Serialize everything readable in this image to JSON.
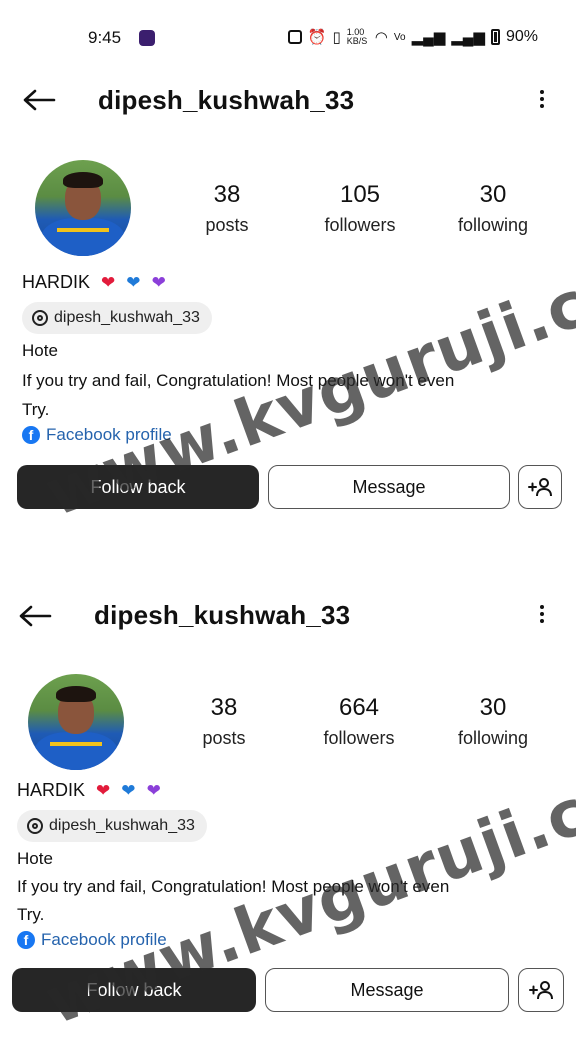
{
  "status_bar": {
    "time": "9:45",
    "net_speed": "1.00 KB/S",
    "battery": "90%"
  },
  "watermark": "www.kvguruji.com",
  "profiles": [
    {
      "username": "dipesh_kushwah_33",
      "stats": [
        {
          "value": "38",
          "label": "posts"
        },
        {
          "value": "105",
          "label": "followers"
        },
        {
          "value": "30",
          "label": "following"
        }
      ],
      "display_name": "HARDIK",
      "threads_handle": "dipesh_kushwah_33",
      "bio_lines": [
        "Hote",
        "If you try and fail, Congratulation! Most people won't even",
        "Try."
      ],
      "link_text": "Facebook profile",
      "buttons": {
        "follow": "Follow back",
        "message": "Message"
      }
    },
    {
      "username": "dipesh_kushwah_33",
      "stats": [
        {
          "value": "38",
          "label": "posts"
        },
        {
          "value": "664",
          "label": "followers"
        },
        {
          "value": "30",
          "label": "following"
        }
      ],
      "display_name": "HARDIK",
      "threads_handle": "dipesh_kushwah_33",
      "bio_lines": [
        "Hote",
        "If you try and fail, Congratulation! Most people won't even",
        "Try."
      ],
      "link_text": "Facebook profile",
      "buttons": {
        "follow": "Follow back",
        "message": "Message"
      }
    }
  ],
  "colors": {
    "follow_button_bg": "#262626",
    "link": "#2563ad",
    "heart_red": "#e21b3b",
    "heart_blue": "#1f7ad8",
    "heart_purple": "#8b3fd9"
  }
}
